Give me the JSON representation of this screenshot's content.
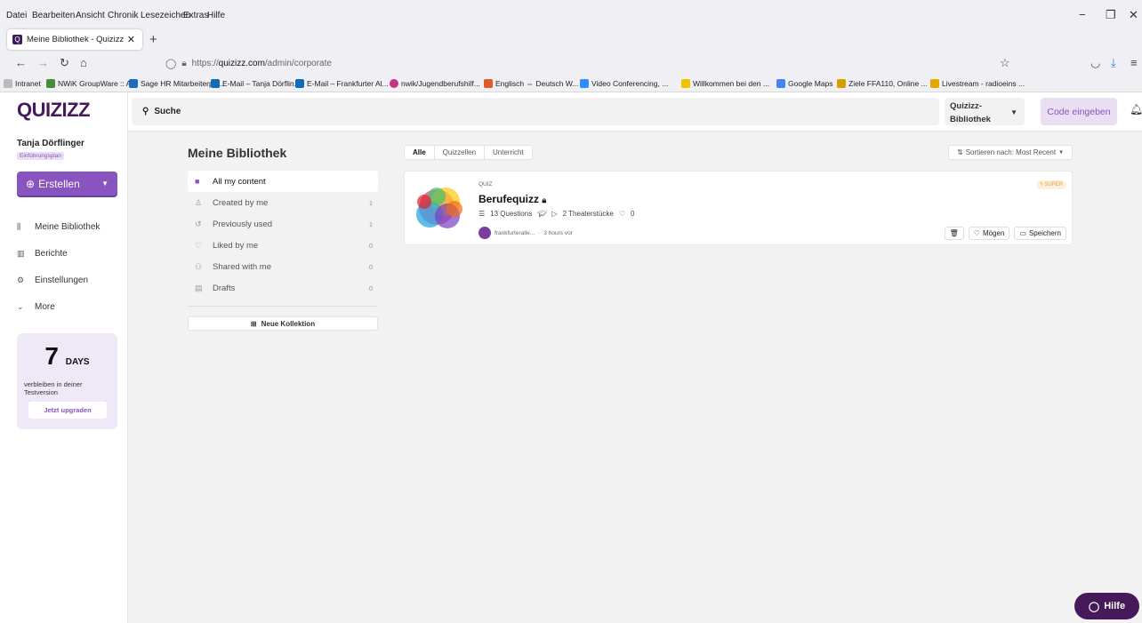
{
  "browser": {
    "menu": [
      "Datei",
      "Bearbeiten",
      "Ansicht",
      "Chronik",
      "Lesezeichen",
      "Extras",
      "Hilfe"
    ],
    "tab_title": "Meine Bibliothek - Quizizz",
    "url_prefix": "https://",
    "url_host": "quizizz.com",
    "url_path": "/admin/corporate",
    "bookmarks": [
      "Intranet",
      "NWiK GroupWare :: A...",
      "Sage HR Mitarbeiterpo...",
      "E-Mail – Tanja Dörflin...",
      "E-Mail – Frankfurter Al...",
      "nwik/Jugendberufshilf...",
      "Englisch ⇔ Deutsch W...",
      "Video Conferencing, ...",
      "Willkommen bei den ...",
      "Google Maps",
      "Ziele FFA110, Online ...",
      "Livestream - radioeins ..."
    ]
  },
  "header": {
    "logo": "QUIZIZZ",
    "search": "Suche",
    "library_selector": "Quizizz-Bibliothek",
    "code_button": "Code eingeben"
  },
  "sidebar": {
    "user": "Tanja Dörflinger",
    "plan": "Einführungsplan",
    "create": "Erstellen",
    "nav": [
      "Meine Bibliothek",
      "Berichte",
      "Einstellungen",
      "More"
    ],
    "trial": {
      "days": "7",
      "unit": "DAYS",
      "text": "verbleiben in deiner Testversion",
      "button": "Jetzt upgraden"
    }
  },
  "main": {
    "title": "Meine Bibliothek",
    "filters": [
      "Alle",
      "Quizzellen",
      "Unterricht"
    ],
    "sort": "Sortieren nach: Most Recent",
    "collections": [
      {
        "label": "All my content",
        "count": ""
      },
      {
        "label": "Created by me",
        "count": "1"
      },
      {
        "label": "Previously used",
        "count": "1"
      },
      {
        "label": "Liked by me",
        "count": "0"
      },
      {
        "label": "Shared with me",
        "count": "0"
      },
      {
        "label": "Drafts",
        "count": "0"
      }
    ],
    "new_collection": "Neue Kollektion",
    "card": {
      "type": "QUIZ",
      "badge": "SUPER",
      "title": "Berufequizz",
      "questions": "13 Questions",
      "plays": "2 Theaterstücke",
      "likes": "0",
      "author": "frankfurteralle...",
      "time": "3 hours vor",
      "like_btn": "Mögen",
      "save_btn": "Speichern"
    }
  },
  "help": "Hilfe"
}
